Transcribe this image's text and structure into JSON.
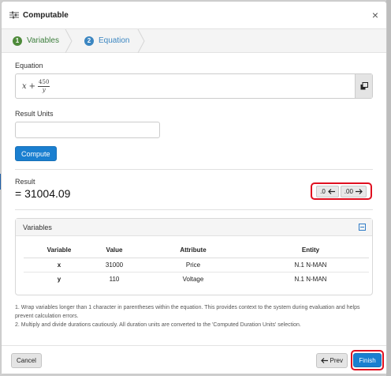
{
  "dialog": {
    "title": "Computable",
    "title_icon": "sliders-icon",
    "close_glyph": "×"
  },
  "steps": [
    {
      "number": "1",
      "label": "Variables",
      "color": "#4e8a3a"
    },
    {
      "number": "2",
      "label": "Equation",
      "color": "#3b86c1"
    }
  ],
  "equation": {
    "label": "Equation",
    "var_x": "x",
    "plus": "+",
    "numerator": "450",
    "denominator": "y",
    "copy_icon": "copy-icon"
  },
  "units": {
    "label": "Result Units",
    "value": "",
    "placeholder": ""
  },
  "compute_label": "Compute",
  "result": {
    "label": "Result",
    "value": "= 31004.09",
    "decrease_label": ".0",
    "increase_label": ".00"
  },
  "variables_panel": {
    "title": "Variables",
    "headers": [
      "Variable",
      "Value",
      "Attribute",
      "Entity"
    ],
    "rows": [
      [
        "x",
        "31000",
        "Price",
        "N.1 N-MAN"
      ],
      [
        "y",
        "110",
        "Voltage",
        "N.1 N-MAN"
      ]
    ]
  },
  "notes": [
    "1. Wrap variables longer than 1 character in parentheses within the equation. This provides context to the system during evaluation and helps prevent calculation errors.",
    "2. Multiply and divide durations cautiously. All duration units are converted to the 'Computed Duration Units' selection."
  ],
  "footer": {
    "cancel_label": "Cancel",
    "prev_label": "Prev",
    "finish_label": "Finish"
  },
  "colors": {
    "primary": "#1a7fd0",
    "highlight": "#e01020",
    "step_done": "#4e8a3a",
    "step_active": "#3b86c1"
  }
}
